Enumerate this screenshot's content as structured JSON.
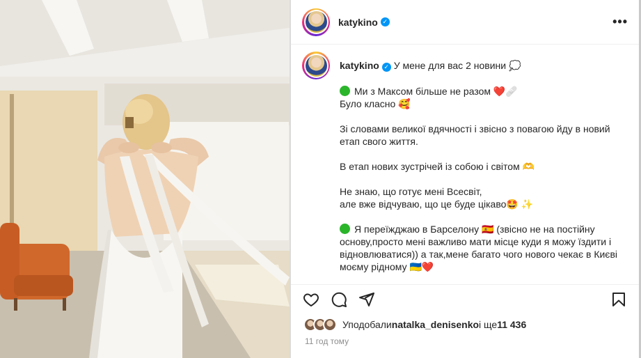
{
  "post": {
    "username": "katykino",
    "verified_badge": "verified-badge-icon",
    "more_icon": "more-options-icon"
  },
  "caption": {
    "username": "katykino",
    "intro": "У мене для вас 2 новини 💭",
    "paragraphs": [
      {
        "bullet": "green-circle-icon",
        "lines": [
          "Ми з Максом більше не разом ❤️🩹",
          "Було класно 🥰"
        ]
      },
      {
        "lines": [
          "Зі словами великої вдячності і звісно з повагою йду в новий етап свого життя."
        ]
      },
      {
        "lines": [
          "В етап нових зустрічей із собою і світом 🫶"
        ]
      },
      {
        "lines": [
          "Не знаю, що готує мені Всесвіт,",
          "але вже відчуваю, що це буде цікаво🤩 ✨"
        ]
      },
      {
        "bullet": "green-circle-icon",
        "lines": [
          "Я переїжджаю в Барселону 🇪🇸 (звісно не на постійну основу,просто мені важливо мати місце куди я можу їздити і відновлюватися)) а так,мене багато чого нового чекає в Києві моєму рідному 🇺🇦❤️"
        ]
      }
    ]
  },
  "actions": {
    "like_icon": "heart-icon",
    "comment_icon": "comment-icon",
    "share_icon": "share-icon",
    "save_icon": "bookmark-icon"
  },
  "likes": {
    "prefix": "Уподобали ",
    "user": "natalka_denisenko",
    "middle": " і ще ",
    "count": "11 436"
  },
  "timestamp": "11 год тому",
  "colors": {
    "accent": "#0095f6",
    "green_dot": "#2bb52b",
    "heart": "#ed4956"
  }
}
